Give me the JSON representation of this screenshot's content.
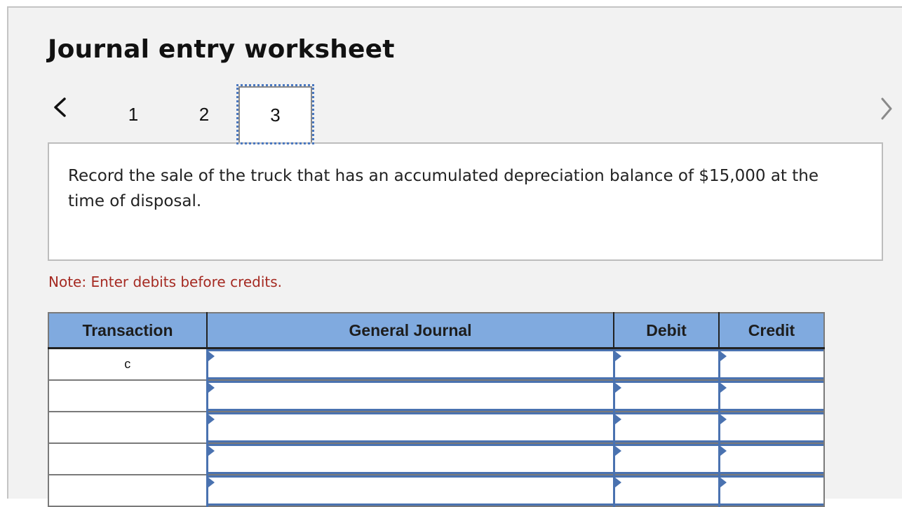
{
  "title": "Journal entry worksheet",
  "navigation": {
    "prev_icon": "chevron-left-icon",
    "next_icon": "chevron-right-icon",
    "tabs": [
      {
        "label": "1",
        "active": false
      },
      {
        "label": "2",
        "active": false
      },
      {
        "label": "3",
        "active": true
      }
    ]
  },
  "prompt": "Record the sale of the truck that has an accumulated depreciation balance of $15,000 at the time of disposal.",
  "note": "Note: Enter debits before credits.",
  "colors": {
    "header_bg": "#80aadf",
    "input_accent": "#4a72b0",
    "note_text": "#a52a22",
    "focus_outline": "#4a78c0"
  },
  "journal": {
    "headers": {
      "transaction": "Transaction",
      "general_journal": "General Journal",
      "debit": "Debit",
      "credit": "Credit"
    },
    "rows": [
      {
        "transaction": "c",
        "account": "",
        "debit": "",
        "credit": ""
      },
      {
        "transaction": "",
        "account": "",
        "debit": "",
        "credit": ""
      },
      {
        "transaction": "",
        "account": "",
        "debit": "",
        "credit": ""
      },
      {
        "transaction": "",
        "account": "",
        "debit": "",
        "credit": ""
      }
    ]
  }
}
